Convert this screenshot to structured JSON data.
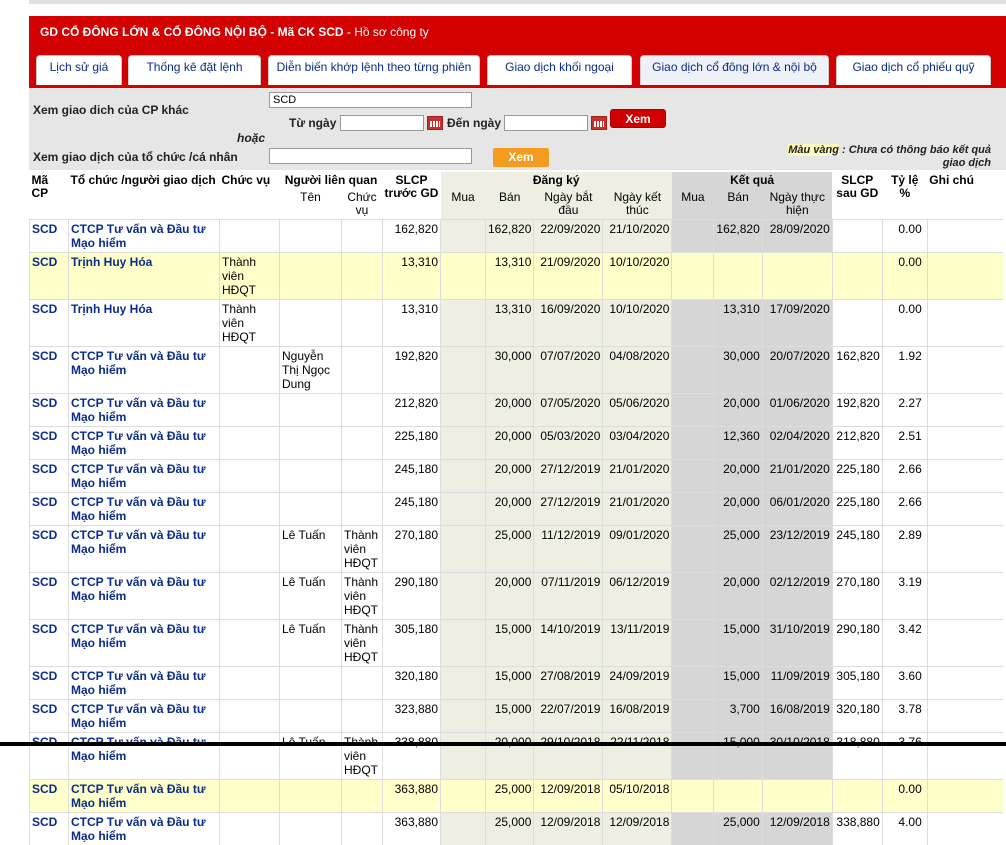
{
  "header": {
    "title_bold": "GD CỔ ĐÔNG LỚN & CỔ ĐÔNG NỘI BỘ - Mã CK SCD",
    "title_link": " - Hồ sơ công ty"
  },
  "tabs": [
    {
      "label": "Lịch sử giá"
    },
    {
      "label": "Thống kê đặt lệnh"
    },
    {
      "label": "Diễn biến khớp lệnh theo từng phiên"
    },
    {
      "label": "Giao dịch khối ngoại"
    },
    {
      "label": "Giao dịch cổ đông lớn & nội bộ"
    },
    {
      "label": "Giao dịch cổ phiếu quỹ"
    }
  ],
  "search": {
    "other_stock_label": "Xem giao dich của CP khác",
    "stock_value": "SCD",
    "from_label": "Từ ngày",
    "to_label": "Đến ngày",
    "from_value": "",
    "to_value": "",
    "view_button": "Xem",
    "or_label": "hoặc",
    "org_label": "Xem giao dịch của tổ chức /cá nhân",
    "org_value": "",
    "view_button2": "Xem",
    "note_highlight": "Màu vàng",
    "note_text": " : Chưa có thông báo kết quả giao dịch"
  },
  "columns": {
    "ma_cp": "Mã CP",
    "to_chuc": "Tổ chức /người giao dịch",
    "chuc_vu": "Chức vụ",
    "nguoi_lien_quan": "Người liên quan",
    "ten": "Tên",
    "chuc_vu_lq": "Chức vụ",
    "slcp_truoc": "SLCP trước GD",
    "dang_ky": "Đăng ký",
    "mua": "Mua",
    "ban": "Bán",
    "ngay_bat_dau": "Ngày bắt đầu",
    "ngay_ket_thuc": "Ngày kết thúc",
    "ket_qua": "Kết quả",
    "mua2": "Mua",
    "ban2": "Bán",
    "ngay_thuc_hien": "Ngày thực hiện",
    "slcp_sau": "SLCP sau GD",
    "ty_le": "Tỷ lệ %",
    "ghi_chu": "Ghi chú"
  },
  "rows": [
    {
      "ma": "SCD",
      "org": "CTCP Tư vấn và Đầu tư Mạo hiểm",
      "cv": "",
      "ten": "",
      "cvlq": "",
      "truoc": "162,820",
      "rmua": "",
      "rban": "162,820",
      "bd": "22/09/2020",
      "kt": "21/10/2020",
      "kmua": "",
      "kban": "162,820",
      "th": "28/09/2020",
      "sau": "",
      "tl": "0.00",
      "gc": "",
      "yellow": false
    },
    {
      "ma": "SCD",
      "org": "Trịnh Huy Hóa",
      "cv": "Thành viên HĐQT",
      "ten": "",
      "cvlq": "",
      "truoc": "13,310",
      "rmua": "",
      "rban": "13,310",
      "bd": "21/09/2020",
      "kt": "10/10/2020",
      "kmua": "",
      "kban": "",
      "th": "",
      "sau": "",
      "tl": "0.00",
      "gc": "",
      "yellow": true
    },
    {
      "ma": "SCD",
      "org": "Trịnh Huy Hóa",
      "cv": "Thành viên HĐQT",
      "ten": "",
      "cvlq": "",
      "truoc": "13,310",
      "rmua": "",
      "rban": "13,310",
      "bd": "16/09/2020",
      "kt": "10/10/2020",
      "kmua": "",
      "kban": "13,310",
      "th": "17/09/2020",
      "sau": "",
      "tl": "0.00",
      "gc": "",
      "yellow": false
    },
    {
      "ma": "SCD",
      "org": "CTCP Tư vấn và Đầu tư Mạo hiểm",
      "cv": "",
      "ten": "Nguyễn Thị Ngọc Dung",
      "cvlq": "",
      "truoc": "192,820",
      "rmua": "",
      "rban": "30,000",
      "bd": "07/07/2020",
      "kt": "04/08/2020",
      "kmua": "",
      "kban": "30,000",
      "th": "20/07/2020",
      "sau": "162,820",
      "tl": "1.92",
      "gc": "",
      "yellow": false
    },
    {
      "ma": "SCD",
      "org": "CTCP Tư vấn và Đầu tư Mạo hiểm",
      "cv": "",
      "ten": "",
      "cvlq": "",
      "truoc": "212,820",
      "rmua": "",
      "rban": "20,000",
      "bd": "07/05/2020",
      "kt": "05/06/2020",
      "kmua": "",
      "kban": "20,000",
      "th": "01/06/2020",
      "sau": "192,820",
      "tl": "2.27",
      "gc": "",
      "yellow": false
    },
    {
      "ma": "SCD",
      "org": "CTCP Tư vấn và Đầu tư Mạo hiểm",
      "cv": "",
      "ten": "",
      "cvlq": "",
      "truoc": "225,180",
      "rmua": "",
      "rban": "20,000",
      "bd": "05/03/2020",
      "kt": "03/04/2020",
      "kmua": "",
      "kban": "12,360",
      "th": "02/04/2020",
      "sau": "212,820",
      "tl": "2.51",
      "gc": "",
      "yellow": false
    },
    {
      "ma": "SCD",
      "org": "CTCP Tư vấn và Đầu tư Mạo hiểm",
      "cv": "",
      "ten": "",
      "cvlq": "",
      "truoc": "245,180",
      "rmua": "",
      "rban": "20,000",
      "bd": "27/12/2019",
      "kt": "21/01/2020",
      "kmua": "",
      "kban": "20,000",
      "th": "21/01/2020",
      "sau": "225,180",
      "tl": "2.66",
      "gc": "",
      "yellow": false
    },
    {
      "ma": "SCD",
      "org": "CTCP Tư vấn và Đầu tư Mạo hiểm",
      "cv": "",
      "ten": "",
      "cvlq": "",
      "truoc": "245,180",
      "rmua": "",
      "rban": "20,000",
      "bd": "27/12/2019",
      "kt": "21/01/2020",
      "kmua": "",
      "kban": "20,000",
      "th": "06/01/2020",
      "sau": "225,180",
      "tl": "2.66",
      "gc": "",
      "yellow": false
    },
    {
      "ma": "SCD",
      "org": "CTCP Tư vấn và Đầu tư Mạo hiểm",
      "cv": "",
      "ten": "Lê Tuấn",
      "cvlq": "Thành viên HĐQT",
      "truoc": "270,180",
      "rmua": "",
      "rban": "25,000",
      "bd": "11/12/2019",
      "kt": "09/01/2020",
      "kmua": "",
      "kban": "25,000",
      "th": "23/12/2019",
      "sau": "245,180",
      "tl": "2.89",
      "gc": "",
      "yellow": false
    },
    {
      "ma": "SCD",
      "org": "CTCP Tư vấn và Đầu tư Mạo hiểm",
      "cv": "",
      "ten": "Lê Tuấn",
      "cvlq": "Thành viên HĐQT",
      "truoc": "290,180",
      "rmua": "",
      "rban": "20,000",
      "bd": "07/11/2019",
      "kt": "06/12/2019",
      "kmua": "",
      "kban": "20,000",
      "th": "02/12/2019",
      "sau": "270,180",
      "tl": "3.19",
      "gc": "",
      "yellow": false
    },
    {
      "ma": "SCD",
      "org": "CTCP Tư vấn và Đầu tư Mạo hiểm",
      "cv": "",
      "ten": "Lê Tuấn",
      "cvlq": "Thành viên HĐQT",
      "truoc": "305,180",
      "rmua": "",
      "rban": "15,000",
      "bd": "14/10/2019",
      "kt": "13/11/2019",
      "kmua": "",
      "kban": "15,000",
      "th": "31/10/2019",
      "sau": "290,180",
      "tl": "3.42",
      "gc": "",
      "yellow": false
    },
    {
      "ma": "SCD",
      "org": "CTCP Tư vấn và Đầu tư Mạo hiểm",
      "cv": "",
      "ten": "",
      "cvlq": "",
      "truoc": "320,180",
      "rmua": "",
      "rban": "15,000",
      "bd": "27/08/2019",
      "kt": "24/09/2019",
      "kmua": "",
      "kban": "15,000",
      "th": "11/09/2019",
      "sau": "305,180",
      "tl": "3.60",
      "gc": "",
      "yellow": false
    },
    {
      "ma": "SCD",
      "org": "CTCP Tư vấn và Đầu tư Mạo hiểm",
      "cv": "",
      "ten": "",
      "cvlq": "",
      "truoc": "323,880",
      "rmua": "",
      "rban": "15,000",
      "bd": "22/07/2019",
      "kt": "16/08/2019",
      "kmua": "",
      "kban": "3,700",
      "th": "16/08/2019",
      "sau": "320,180",
      "tl": "3.78",
      "gc": "",
      "yellow": false
    },
    {
      "ma": "SCD",
      "org": "CTCP Tư vấn và Đầu tư Mạo hiểm",
      "cv": "",
      "ten": "Lê Tuấn",
      "cvlq": "Thành viên HĐQT",
      "truoc": "338,880",
      "rmua": "",
      "rban": "20,000",
      "bd": "29/10/2018",
      "kt": "22/11/2018",
      "kmua": "",
      "kban": "15,000",
      "th": "30/10/2018",
      "sau": "318,880",
      "tl": "3.76",
      "gc": "",
      "yellow": false
    },
    {
      "ma": "SCD",
      "org": "CTCP Tư vấn và Đầu tư Mạo hiểm",
      "cv": "",
      "ten": "",
      "cvlq": "",
      "truoc": "363,880",
      "rmua": "",
      "rban": "25,000",
      "bd": "12/09/2018",
      "kt": "05/10/2018",
      "kmua": "",
      "kban": "",
      "th": "",
      "sau": "",
      "tl": "0.00",
      "gc": "",
      "yellow": true
    },
    {
      "ma": "SCD",
      "org": "CTCP Tư vấn và Đầu tư Mạo hiểm",
      "cv": "",
      "ten": "",
      "cvlq": "",
      "truoc": "363,880",
      "rmua": "",
      "rban": "25,000",
      "bd": "12/09/2018",
      "kt": "12/09/2018",
      "kmua": "",
      "kban": "25,000",
      "th": "12/09/2018",
      "sau": "338,880",
      "tl": "4.00",
      "gc": "",
      "yellow": false
    }
  ]
}
